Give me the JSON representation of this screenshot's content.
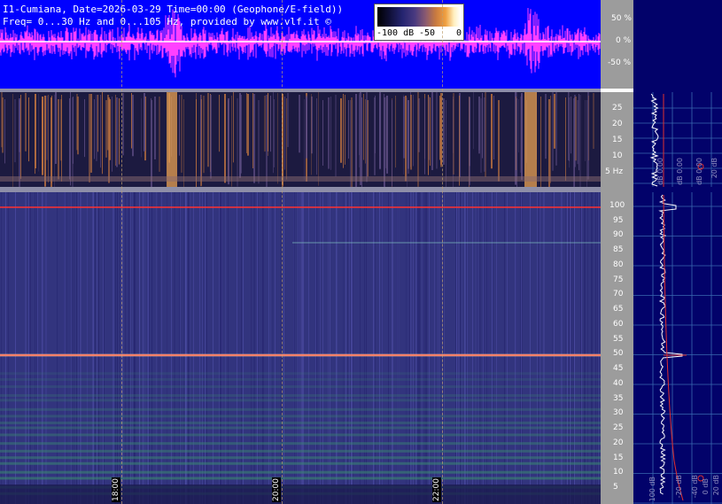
{
  "title": {
    "line1": "I1-Cumiana, Date=2026-03-29 Time=00:00 (Geophone/E-field))",
    "line2": "Freq= 0...30 Hz and 0...105 Hz, provided by www.vlf.it ©"
  },
  "colorbar": {
    "labels": [
      "-100 dB",
      "-50",
      "0"
    ]
  },
  "amplitude_axis": {
    "ticks": [
      "50 %",
      "0 %",
      "-50 %"
    ]
  },
  "low_freq_axis": {
    "ticks": [
      "25",
      "20",
      "15",
      "10",
      "5 Hz"
    ]
  },
  "high_freq_axis": {
    "ticks": [
      "100",
      "95",
      "90",
      "85",
      "80",
      "75",
      "70",
      "65",
      "60",
      "55",
      "50",
      "45",
      "40",
      "35",
      "30",
      "25",
      "20",
      "15",
      "10",
      "5"
    ]
  },
  "time_axis": {
    "ticks": [
      "18:00",
      "20:00",
      "22:00"
    ]
  },
  "right_panel": {
    "top_labels": [
      "dB 0.00",
      "dB 0.00",
      "dB 0.00",
      "20 dB"
    ],
    "bottom_labels": [
      "100 dB",
      "-20 dB",
      "-40 dB",
      "0 dB",
      "20 dB"
    ]
  },
  "colors": {
    "waveform": "#ff40ff",
    "background_blue": "#0000ff",
    "mains_line": "#ff3030",
    "spectrum_line": "#ffffff"
  }
}
